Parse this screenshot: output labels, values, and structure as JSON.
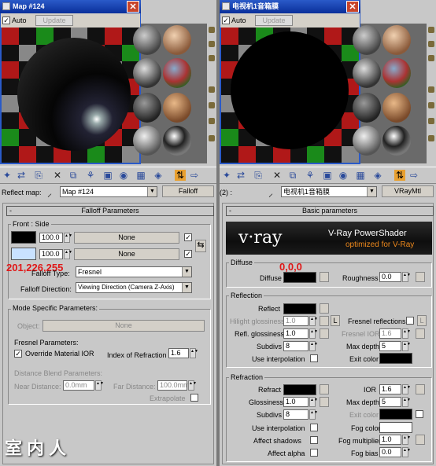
{
  "left": {
    "window_title": "Map #124",
    "auto_label": "Auto",
    "update_label": "Update",
    "reflect_label": "Reflect map:",
    "map_name": "Map #124",
    "map_type": "Falloff",
    "rollout_title": "Falloff Parameters",
    "front_side": "Front : Side",
    "spin1": "100.0",
    "spin2": "100.0",
    "none1": "None",
    "none2": "None",
    "color_annotation": "201,226,255",
    "falloff_type_label": "Falloff Type:",
    "falloff_type": "Fresnel",
    "falloff_dir_label": "Falloff Direction:",
    "falloff_dir": "Viewing Direction (Camera Z-Axis)",
    "mode_group": "Mode Specific Parameters:",
    "object_label": "Object:",
    "object_value": "None",
    "fresnel_label": "Fresnel Parameters:",
    "override_label": "Override Material IOR",
    "ior_label": "Index of Refraction",
    "ior_value": "1.6",
    "distance_label": "Distance Blend Parameters:",
    "near_label": "Near Distance:",
    "near_value": "0.0mm",
    "far_label": "Far Distance:",
    "far_value": "100.0mm",
    "extrapolate_label": "Extrapolate"
  },
  "right": {
    "window_title": "电视机1音箱膜",
    "auto_label": "Auto",
    "update_label": "Update",
    "slot_label": "(2) :",
    "mat_name": "电视机1音箱膜",
    "mat_type": "VRayMtl",
    "rollout_title": "Basic parameters",
    "vray_logo": "v·ray",
    "vray_title": "V-Ray PowerShader",
    "vray_sub": "optimized for V-Ray",
    "diffuse_group": "Diffuse",
    "diffuse_annotation": "0,0,0",
    "diffuse_label": "Diffuse",
    "roughness_label": "Roughness",
    "roughness_value": "0.0",
    "reflection_group": "Reflection",
    "reflect_label": "Reflect",
    "hilight_label": "Hilight glossiness",
    "hilight_value": "1.0",
    "l_label": "L",
    "fresnel_label": "Fresnel reflections",
    "refl_gloss_label": "Refl. glossiness",
    "refl_gloss_value": "1.0",
    "fresnel_ior_label": "Fresnel IOR",
    "fresnel_ior_value": "1.6",
    "subdivs_label": "Subdivs",
    "subdivs_value": "8",
    "max_depth_label": "Max depth",
    "max_depth_value": "5",
    "use_interp_label": "Use interpolation",
    "exit_color_label": "Exit color",
    "refraction_group": "Refraction",
    "refract_label": "Refract",
    "ior_label": "IOR",
    "ior_value": "1.6",
    "gloss_label": "Glossiness",
    "gloss_value": "1.0",
    "rmax_depth_label": "Max depth",
    "rmax_depth_value": "5",
    "rsubdivs_label": "Subdivs",
    "rsubdivs_value": "8",
    "rexit_label": "Exit color",
    "ruse_interp_label": "Use interpolation",
    "fog_color_label": "Fog color",
    "affect_shadows_label": "Affect shadows",
    "fog_mult_label": "Fog multiplier",
    "fog_mult_value": "1.0",
    "affect_alpha_label": "Affect alpha",
    "fog_bias_label": "Fog bias",
    "fog_bias_value": "0.0"
  },
  "watermark": "室内人",
  "colors": {
    "title_bar": "#0a2f9a",
    "annotation": "#e01818",
    "vray_orange": "#f08a1c"
  }
}
